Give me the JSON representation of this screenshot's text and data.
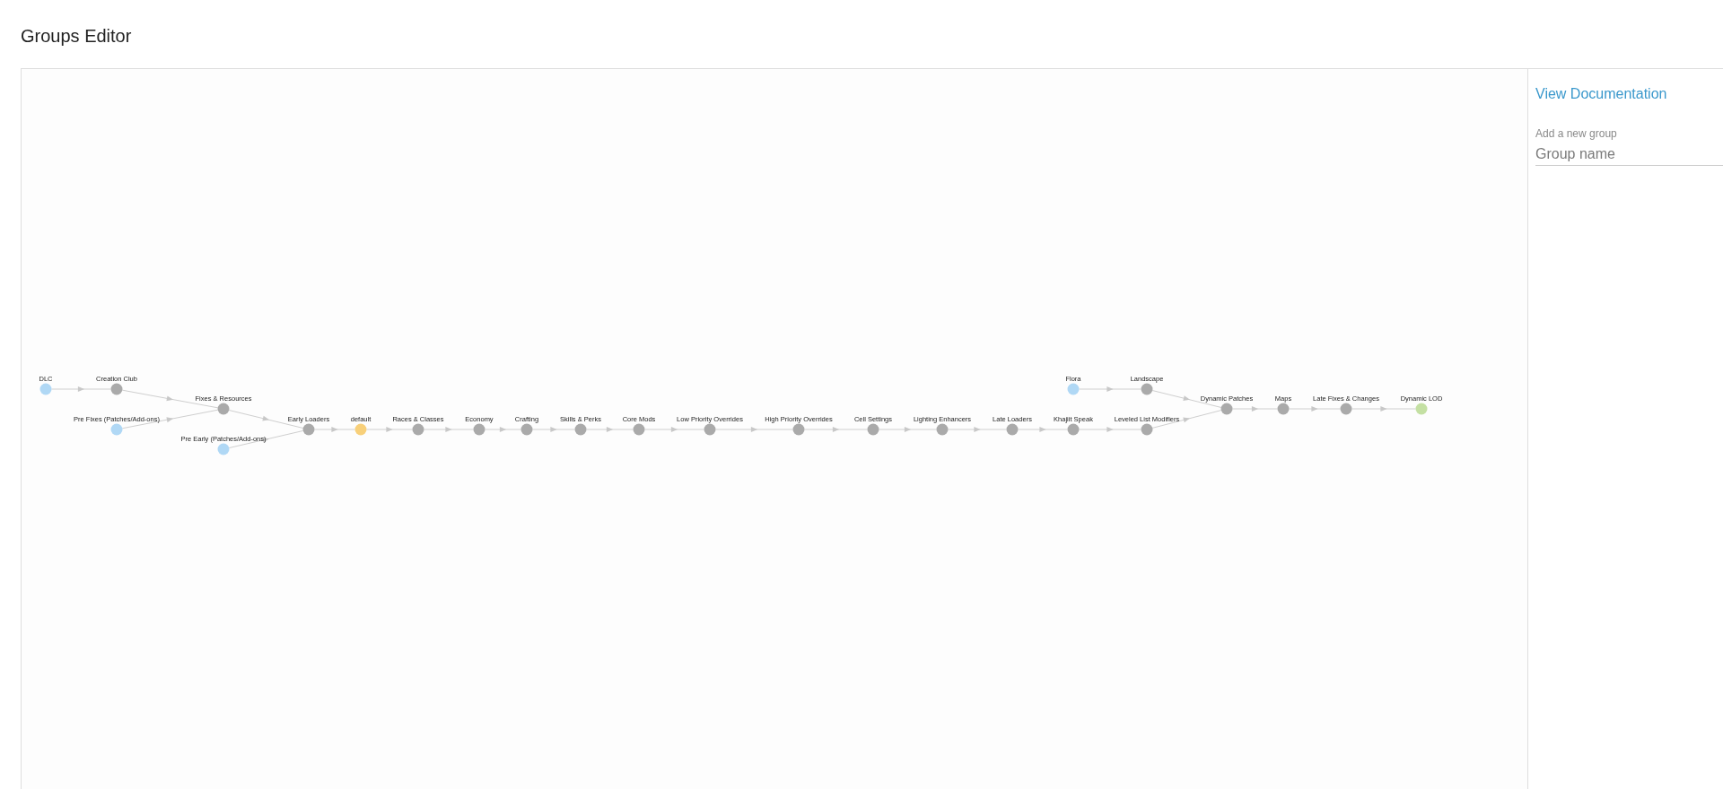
{
  "page": {
    "title": "Groups Editor"
  },
  "graph": {
    "nodes": [
      {
        "label": "DLC",
        "color": "#b0d8f5"
      },
      {
        "label": "Creation Club",
        "color": "#aaaaaa"
      },
      {
        "label": "Pre Fixes (Patches/Add-ons)",
        "color": "#b0d8f5"
      },
      {
        "label": "Fixes & Resources",
        "color": "#aaaaaa"
      },
      {
        "label": "Pre Early (Patches/Add-ons)",
        "color": "#b0d8f5"
      },
      {
        "label": "Early Loaders",
        "color": "#aaaaaa"
      },
      {
        "label": "default",
        "color": "#f8d07a"
      },
      {
        "label": "Races & Classes",
        "color": "#aaaaaa"
      },
      {
        "label": "Economy",
        "color": "#aaaaaa"
      },
      {
        "label": "Crafting",
        "color": "#aaaaaa"
      },
      {
        "label": "Skills & Perks",
        "color": "#aaaaaa"
      },
      {
        "label": "Core Mods",
        "color": "#aaaaaa"
      },
      {
        "label": "Low Priority Overrides",
        "color": "#aaaaaa"
      },
      {
        "label": "High Priority Overrides",
        "color": "#aaaaaa"
      },
      {
        "label": "Cell Settings",
        "color": "#aaaaaa"
      },
      {
        "label": "Lighting Enhancers",
        "color": "#aaaaaa"
      },
      {
        "label": "Late Loaders",
        "color": "#aaaaaa"
      },
      {
        "label": "Flora",
        "color": "#b0d8f5"
      },
      {
        "label": "Khajiit Speak",
        "color": "#aaaaaa"
      },
      {
        "label": "Landscape",
        "color": "#aaaaaa"
      },
      {
        "label": "Leveled List Modifiers",
        "color": "#aaaaaa"
      },
      {
        "label": "Dynamic Patches",
        "color": "#aaaaaa"
      },
      {
        "label": "Maps",
        "color": "#aaaaaa"
      },
      {
        "label": "Late Fixes & Changes",
        "color": "#aaaaaa"
      },
      {
        "label": "Dynamic LOD",
        "color": "#c4e0a3"
      }
    ]
  },
  "sidebar": {
    "documentation_link": "View Documentation",
    "new_group": {
      "label": "Add a new group",
      "placeholder": "Group name"
    }
  }
}
